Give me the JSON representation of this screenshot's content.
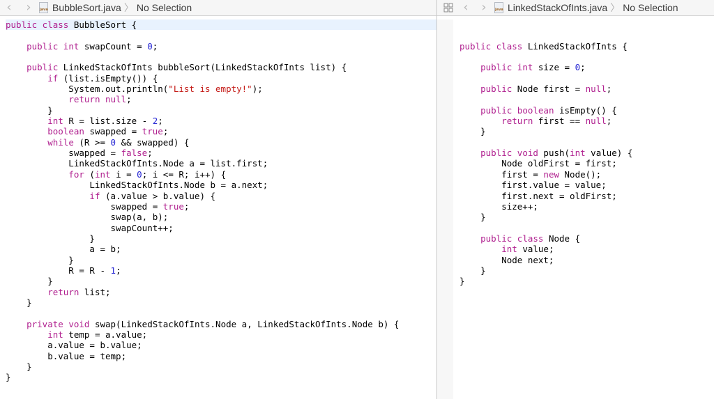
{
  "left_editor": {
    "file_name": "BubbleSort.java",
    "selection": "No Selection",
    "file_icon_label": "java",
    "back_icon": "chevron-left-icon",
    "forward_icon": "chevron-right-icon",
    "lines": [
      [
        [
          "kw",
          "public class "
        ],
        [
          "t",
          "BubbleSort {"
        ]
      ],
      [],
      [
        [
          "t",
          "    "
        ],
        [
          "kw",
          "public int "
        ],
        [
          "t",
          "swapCount = "
        ],
        [
          "num",
          "0"
        ],
        [
          "t",
          ";"
        ]
      ],
      [],
      [
        [
          "t",
          "    "
        ],
        [
          "kw",
          "public "
        ],
        [
          "t",
          "LinkedStackOfInts bubbleSort(LinkedStackOfInts list) {"
        ]
      ],
      [
        [
          "t",
          "        "
        ],
        [
          "kw",
          "if "
        ],
        [
          "t",
          "(list.isEmpty()) {"
        ]
      ],
      [
        [
          "t",
          "            System.out.println("
        ],
        [
          "str",
          "\"List is empty!\""
        ],
        [
          "t",
          ");"
        ]
      ],
      [
        [
          "t",
          "            "
        ],
        [
          "kw",
          "return null"
        ],
        [
          "t",
          ";"
        ]
      ],
      [
        [
          "t",
          "        }"
        ]
      ],
      [
        [
          "t",
          "        "
        ],
        [
          "kw",
          "int "
        ],
        [
          "t",
          "R = list.size - "
        ],
        [
          "num",
          "2"
        ],
        [
          "t",
          ";"
        ]
      ],
      [
        [
          "t",
          "        "
        ],
        [
          "kw",
          "boolean "
        ],
        [
          "t",
          "swapped = "
        ],
        [
          "kw",
          "true"
        ],
        [
          "t",
          ";"
        ]
      ],
      [
        [
          "t",
          "        "
        ],
        [
          "kw",
          "while "
        ],
        [
          "t",
          "(R >= "
        ],
        [
          "num",
          "0"
        ],
        [
          "t",
          " && swapped) {"
        ]
      ],
      [
        [
          "t",
          "            swapped = "
        ],
        [
          "kw",
          "false"
        ],
        [
          "t",
          ";"
        ]
      ],
      [
        [
          "t",
          "            LinkedStackOfInts.Node a = list.first;"
        ]
      ],
      [
        [
          "t",
          "            "
        ],
        [
          "kw",
          "for "
        ],
        [
          "t",
          "("
        ],
        [
          "kw",
          "int "
        ],
        [
          "t",
          "i = "
        ],
        [
          "num",
          "0"
        ],
        [
          "t",
          "; i <= R; i++) {"
        ]
      ],
      [
        [
          "t",
          "                LinkedStackOfInts.Node b = a.next;"
        ]
      ],
      [
        [
          "t",
          "                "
        ],
        [
          "kw",
          "if "
        ],
        [
          "t",
          "(a.value > b.value) {"
        ]
      ],
      [
        [
          "t",
          "                    swapped = "
        ],
        [
          "kw",
          "true"
        ],
        [
          "t",
          ";"
        ]
      ],
      [
        [
          "t",
          "                    swap(a, b);"
        ]
      ],
      [
        [
          "t",
          "                    swapCount++;"
        ]
      ],
      [
        [
          "t",
          "                }"
        ]
      ],
      [
        [
          "t",
          "                a = b;"
        ]
      ],
      [
        [
          "t",
          "            }"
        ]
      ],
      [
        [
          "t",
          "            R = R - "
        ],
        [
          "num",
          "1"
        ],
        [
          "t",
          ";"
        ]
      ],
      [
        [
          "t",
          "        }"
        ]
      ],
      [
        [
          "t",
          "        "
        ],
        [
          "kw",
          "return "
        ],
        [
          "t",
          "list;"
        ]
      ],
      [
        [
          "t",
          "    }"
        ]
      ],
      [],
      [
        [
          "t",
          "    "
        ],
        [
          "kw",
          "private void "
        ],
        [
          "t",
          "swap(LinkedStackOfInts.Node a, LinkedStackOfInts.Node b) {"
        ]
      ],
      [
        [
          "t",
          "        "
        ],
        [
          "kw",
          "int "
        ],
        [
          "t",
          "temp = a.value;"
        ]
      ],
      [
        [
          "t",
          "        a.value = b.value;"
        ]
      ],
      [
        [
          "t",
          "        b.value = temp;"
        ]
      ],
      [
        [
          "t",
          "    }"
        ]
      ],
      [
        [
          "t",
          "}"
        ]
      ]
    ],
    "highlight_line": 0
  },
  "right_editor": {
    "file_name": "LinkedStackOfInts.java",
    "selection": "No Selection",
    "file_icon_label": "java",
    "grid_icon": "related-items-grid-icon",
    "back_icon": "chevron-left-icon",
    "forward_icon": "chevron-right-icon",
    "lines": [
      [],
      [],
      [
        [
          "kw",
          "public class "
        ],
        [
          "t",
          "LinkedStackOfInts {"
        ]
      ],
      [],
      [
        [
          "t",
          "    "
        ],
        [
          "kw",
          "public int "
        ],
        [
          "t",
          "size = "
        ],
        [
          "num",
          "0"
        ],
        [
          "t",
          ";"
        ]
      ],
      [],
      [
        [
          "t",
          "    "
        ],
        [
          "kw",
          "public "
        ],
        [
          "t",
          "Node first = "
        ],
        [
          "kw",
          "null"
        ],
        [
          "t",
          ";"
        ]
      ],
      [],
      [
        [
          "t",
          "    "
        ],
        [
          "kw",
          "public boolean "
        ],
        [
          "t",
          "isEmpty() {"
        ]
      ],
      [
        [
          "t",
          "        "
        ],
        [
          "kw",
          "return "
        ],
        [
          "t",
          "first == "
        ],
        [
          "kw",
          "null"
        ],
        [
          "t",
          ";"
        ]
      ],
      [
        [
          "t",
          "    }"
        ]
      ],
      [],
      [
        [
          "t",
          "    "
        ],
        [
          "kw",
          "public void "
        ],
        [
          "t",
          "push("
        ],
        [
          "kw",
          "int "
        ],
        [
          "t",
          "value) {"
        ]
      ],
      [
        [
          "t",
          "        Node oldFirst = first;"
        ]
      ],
      [
        [
          "t",
          "        first = "
        ],
        [
          "kw",
          "new "
        ],
        [
          "t",
          "Node();"
        ]
      ],
      [
        [
          "t",
          "        first.value = value;"
        ]
      ],
      [
        [
          "t",
          "        first.next = oldFirst;"
        ]
      ],
      [
        [
          "t",
          "        size++;"
        ]
      ],
      [
        [
          "t",
          "    }"
        ]
      ],
      [],
      [
        [
          "t",
          "    "
        ],
        [
          "kw",
          "public class "
        ],
        [
          "t",
          "Node {"
        ]
      ],
      [
        [
          "t",
          "        "
        ],
        [
          "kw",
          "int "
        ],
        [
          "t",
          "value;"
        ]
      ],
      [
        [
          "t",
          "        Node next;"
        ]
      ],
      [
        [
          "t",
          "    }"
        ]
      ],
      [
        [
          "t",
          "}"
        ]
      ]
    ],
    "highlight_line": 0
  },
  "colors": {
    "keyword": "#b0208f",
    "number": "#2727d4",
    "string": "#c41a16",
    "current_line": "#e8f2fe"
  }
}
